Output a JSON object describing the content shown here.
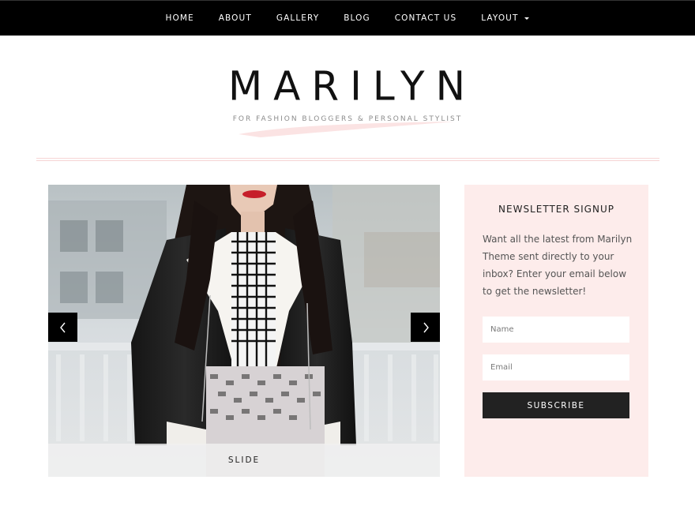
{
  "nav": {
    "items": [
      {
        "label": "HOME"
      },
      {
        "label": "ABOUT"
      },
      {
        "label": "GALLERY"
      },
      {
        "label": "BLOG"
      },
      {
        "label": "CONTACT US"
      },
      {
        "label": "LAYOUT",
        "has_dropdown": true
      }
    ]
  },
  "header": {
    "site_title": "MARILYN",
    "tagline": "FOR FASHION BLOGGERS & PERSONAL STYLIST"
  },
  "slider": {
    "caption": "SLIDE",
    "prev_icon": "chevron-left-icon",
    "next_icon": "chevron-right-icon"
  },
  "newsletter": {
    "title": "NEWSLETTER SIGNUP",
    "description": "Want all the latest from Marilyn Theme sent directly to your inbox? Enter your email below to get the newsletter!",
    "name_placeholder": "Name",
    "email_placeholder": "Email",
    "submit_label": "SUBSCRIBE"
  },
  "colors": {
    "nav_bg": "#000000",
    "accent_pink": "#fdeceb",
    "rule": "#f6d5d5",
    "button_bg": "#222222"
  }
}
